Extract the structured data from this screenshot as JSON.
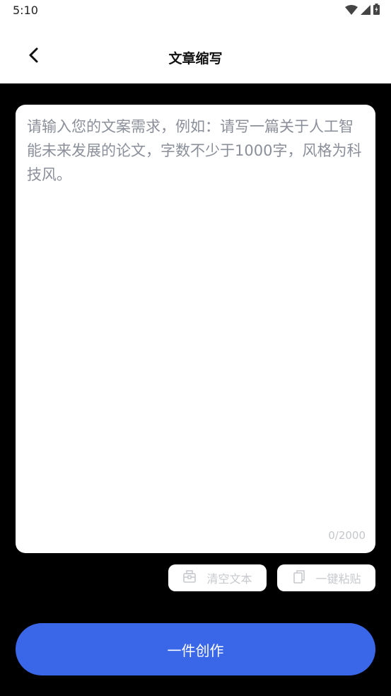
{
  "status_bar": {
    "time": "5:10",
    "icons": [
      "wifi-icon",
      "signal-icon",
      "battery-icon"
    ]
  },
  "header": {
    "title": "文章缩写",
    "back_icon": "chevron-left-icon"
  },
  "editor": {
    "placeholder": "请输入您的文案需求，例如：请写一篇关于人工智能未来发展的论文，字数不少于1000字，风格为科技风。",
    "value": "",
    "char_count": "0/2000"
  },
  "actions": {
    "clear": {
      "label": "清空文本",
      "icon": "clear-icon"
    },
    "paste": {
      "label": "一键粘贴",
      "icon": "copy-icon"
    }
  },
  "create_button": {
    "label": "一件创作"
  },
  "colors": {
    "background": "#000000",
    "header": "#ffffff",
    "accent": "#3a66e8",
    "placeholder": "#8a8f99",
    "muted": "#c7c9cd"
  }
}
